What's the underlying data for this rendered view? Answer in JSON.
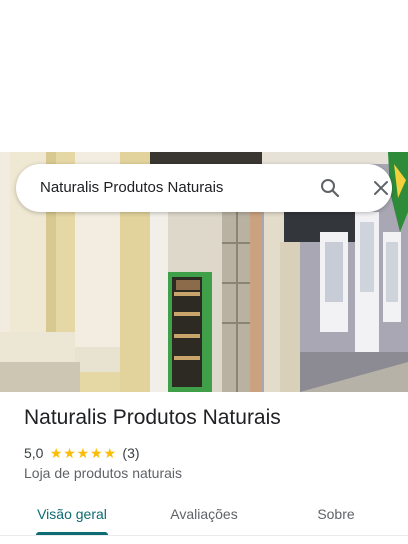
{
  "search": {
    "query": "Naturalis Produtos Naturais",
    "search_icon": "search-icon",
    "close_icon": "close-icon"
  },
  "place": {
    "title": "Naturalis Produtos Naturais",
    "rating": "5,0",
    "stars": 5,
    "review_count": "(3)",
    "category": "Loja de produtos naturais"
  },
  "tabs": [
    {
      "label": "Visão geral",
      "selected": true
    },
    {
      "label": "Avaliações",
      "selected": false
    },
    {
      "label": "Sobre",
      "selected": false
    }
  ],
  "colors": {
    "accent": "#0d6b73",
    "star": "#fbbc04",
    "text_primary": "#202124",
    "text_secondary": "#5f6368"
  }
}
